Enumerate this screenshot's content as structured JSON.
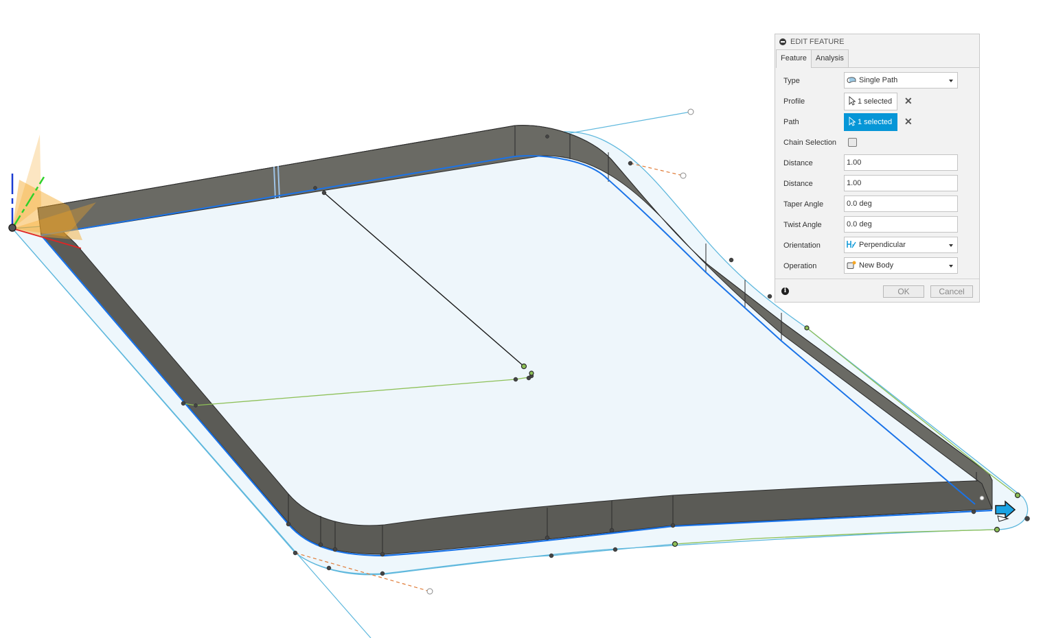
{
  "dialog": {
    "title": "EDIT FEATURE",
    "tabs": [
      {
        "label": "Feature",
        "active": true
      },
      {
        "label": "Analysis",
        "active": false
      }
    ],
    "fields": {
      "type": {
        "label": "Type",
        "value": "Single Path",
        "icon": "single-path-icon"
      },
      "profile": {
        "label": "Profile",
        "value": "1 selected",
        "icon": "cursor-icon"
      },
      "path": {
        "label": "Path",
        "value": "1 selected",
        "icon": "cursor-icon",
        "active": true
      },
      "chain": {
        "label": "Chain Selection",
        "checked": false
      },
      "distance1": {
        "label": "Distance",
        "value": "1.00"
      },
      "distance2": {
        "label": "Distance",
        "value": "1.00"
      },
      "taper": {
        "label": "Taper Angle",
        "value": "0.0 deg"
      },
      "twist": {
        "label": "Twist Angle",
        "value": "0.0 deg"
      },
      "orientation": {
        "label": "Orientation",
        "value": "Perpendicular",
        "icon": "perpendicular-icon"
      },
      "operation": {
        "label": "Operation",
        "value": "New Body",
        "icon": "new-body-icon"
      }
    },
    "clear_glyph": "✕",
    "info_glyph": "i",
    "ok_label": "OK",
    "cancel_label": "Cancel"
  },
  "colors": {
    "accent": "#0696d7",
    "sweep_body": "#5b5b56",
    "sweep_top": "#7a7a74",
    "profile_fill": "#eef7fc",
    "path_blue": "#1a73e8",
    "sketch_cyan": "#5fb8dd",
    "sketch_green": "#8dc057",
    "tangent_orange": "#e07a35",
    "origin_plane": "#f5a623"
  }
}
